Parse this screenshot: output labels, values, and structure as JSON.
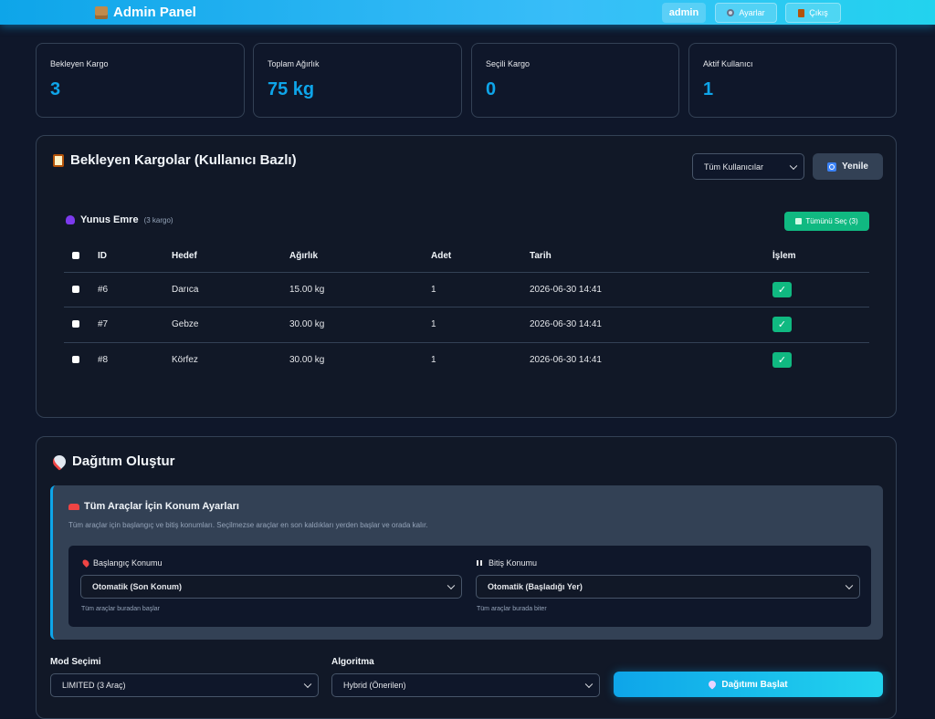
{
  "header": {
    "brand": "Admin Panel",
    "user": "admin",
    "settings_label": "Ayarlar",
    "logout_label": "Çıkış"
  },
  "stats": [
    {
      "label": "Bekleyen Kargo",
      "value": "3"
    },
    {
      "label": "Toplam Ağırlık",
      "value": "75 kg"
    },
    {
      "label": "Seçili Kargo",
      "value": "0"
    },
    {
      "label": "Aktif Kullanıcı",
      "value": "1"
    }
  ],
  "pending": {
    "title": "Bekleyen Kargolar (Kullanıcı Bazlı)",
    "filter_value": "Tüm Kullanıcılar",
    "refresh_label": "Yenile",
    "user_name": "Yunus Emre",
    "user_count": "(3 kargo)",
    "select_all_label": "Tümünü Seç (3)",
    "columns": [
      "ID",
      "Hedef",
      "Ağırlık",
      "Adet",
      "Tarih",
      "İşlem"
    ],
    "rows": [
      {
        "id": "#6",
        "target": "Darıca",
        "weight": "15.00 kg",
        "qty": "1",
        "date": "2026-06-30 14:41",
        "action": "✓"
      },
      {
        "id": "#7",
        "target": "Gebze",
        "weight": "30.00 kg",
        "qty": "1",
        "date": "2026-06-30 14:41",
        "action": "✓"
      },
      {
        "id": "#8",
        "target": "Körfez",
        "weight": "30.00 kg",
        "qty": "1",
        "date": "2026-06-30 14:41",
        "action": "✓"
      }
    ]
  },
  "distribution": {
    "title": "Dağıtım Oluştur",
    "location_title": "Tüm Araçlar İçin Konum Ayarları",
    "location_desc": "Tüm araçlar için başlangıç ve bitiş konumları. Seçilmezse araçlar en son kaldıkları yerden başlar ve orada kalır.",
    "start_label": "Başlangıç Konumu",
    "start_value": "Otomatik (Son Konum)",
    "start_hint": "Tüm araçlar buradan başlar",
    "end_label": "Bitiş Konumu",
    "end_value": "Otomatik (Başladığı Yer)",
    "end_hint": "Tüm araçlar burada biter",
    "mode_label": "Mod Seçimi",
    "mode_value": "LIMITED (3 Araç)",
    "algo_label": "Algoritma",
    "algo_value": "Hybrid (Önerilen)",
    "start_button": "Dağıtımı Başlat"
  }
}
